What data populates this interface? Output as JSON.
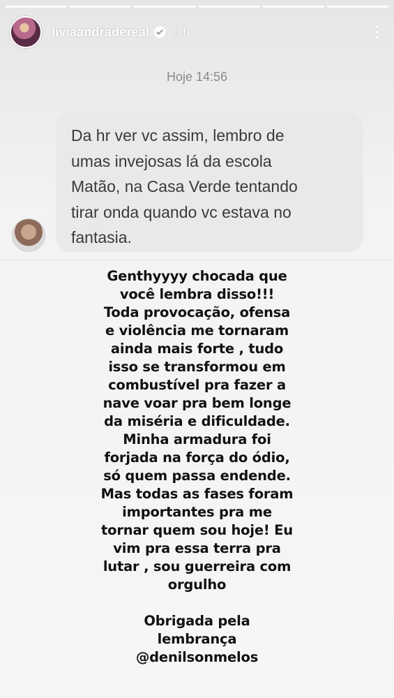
{
  "story": {
    "segments": 6,
    "username": "liviaandradereal",
    "time_ago": "5 h",
    "verified_icon": "verified-badge-icon",
    "more_icon": "more-vertical-icon"
  },
  "chat": {
    "date": "Hoje 14:56",
    "message_lines": [
      "Da hr ver vc assim, lembro de",
      "umas invejosas lá da escola",
      "Matão, na Casa Verde tentando",
      "tirar onda quando vc estava no",
      "fantasia."
    ]
  },
  "reply": {
    "lines": [
      "Genthyyyy chocada que",
      "você lembra disso!!!",
      "Toda provocação, ofensa",
      "e violência me tornaram",
      "ainda mais forte , tudo",
      "isso se transformou em",
      "combustível pra fazer a",
      "nave voar pra bem longe",
      "da miséria e dificuldade.",
      "Minha armadura foi",
      "forjada na força do ódio,",
      "só quem passa endende.",
      "Mas todas as fases foram",
      "importantes pra me",
      "tornar quem sou hoje! Eu",
      "vim pra essa terra pra",
      "lutar , sou guerreira com",
      "orgulho"
    ],
    "closing_lines": [
      "Obrigada pela",
      "lembrança",
      "@denilsonmelos"
    ]
  }
}
